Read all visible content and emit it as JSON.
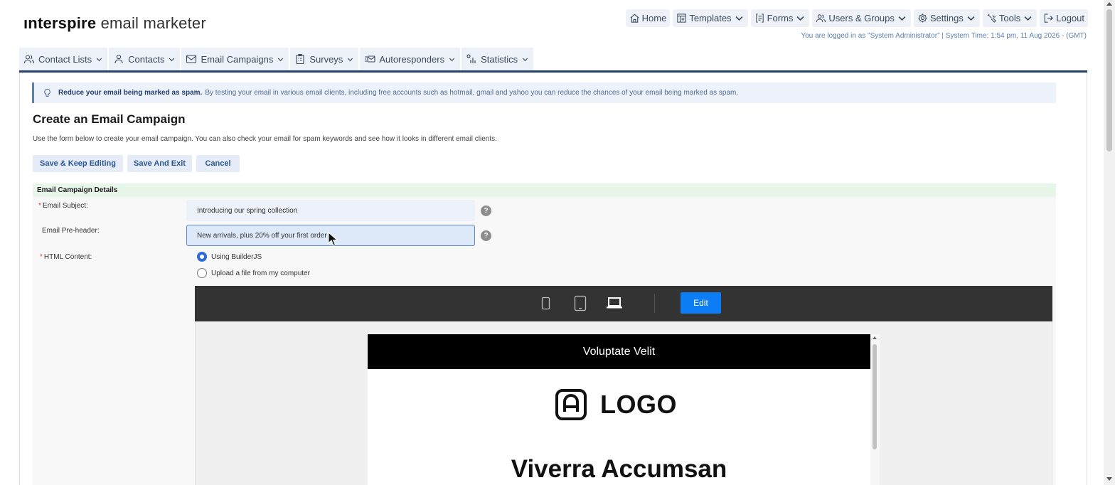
{
  "header": {
    "logo_bold": "ınterspire",
    "logo_light": " email marketer",
    "login_info": "You are logged in as \"System Administrator\" | System Time: 1:54 pm, 11 Aug 2026 - (GMT)"
  },
  "topnav": [
    {
      "label": "Home",
      "icon": "home-icon"
    },
    {
      "label": "Templates",
      "icon": "templates-icon",
      "dropdown": true
    },
    {
      "label": "Forms",
      "icon": "forms-icon",
      "dropdown": true
    },
    {
      "label": "Users & Groups",
      "icon": "users-icon",
      "dropdown": true
    },
    {
      "label": "Settings",
      "icon": "gear-icon",
      "dropdown": true
    },
    {
      "label": "Tools",
      "icon": "tools-icon",
      "dropdown": true
    },
    {
      "label": "Logout",
      "icon": "logout-icon"
    }
  ],
  "mainmenu": [
    {
      "label": "Contact Lists",
      "icon": "contact-lists-icon"
    },
    {
      "label": "Contacts",
      "icon": "contacts-icon"
    },
    {
      "label": "Email Campaigns",
      "icon": "envelope-icon"
    },
    {
      "label": "Surveys",
      "icon": "clipboard-icon"
    },
    {
      "label": "Autoresponders",
      "icon": "autoresponder-icon"
    },
    {
      "label": "Statistics",
      "icon": "statistics-icon"
    }
  ],
  "tip": {
    "bold": "Reduce your email being marked as spam.",
    "text": "By testing your email in various email clients, including free accounts such as hotmail, gmail and yahoo you can reduce the chances of your email being marked as spam."
  },
  "page": {
    "title": "Create an Email Campaign",
    "intro": "Use the form below to create your email campaign. You can also check your email for spam keywords and see how it looks in different email clients."
  },
  "buttons": {
    "save_keep": "Save & Keep Editing",
    "save_exit": "Save And Exit",
    "cancel": "Cancel"
  },
  "form": {
    "section_title": "Email Campaign Details",
    "subject_label": "Email Subject:",
    "subject_value": "Introducing our spring collection",
    "preheader_label": "Email Pre-header:",
    "preheader_value": "New arrivals, plus 20% off your first order",
    "html_label": "HTML Content:",
    "option_builder": "Using BuilderJS",
    "option_upload": "Upload a file from my computer",
    "required_mark": "*",
    "help_mark": "?"
  },
  "builder": {
    "edit_label": "Edit",
    "devices": [
      "mobile-icon",
      "tablet-icon",
      "laptop-icon"
    ],
    "active_device": "laptop-icon",
    "email_top_text": "Voluptate Velit",
    "logo_text": "LOGO",
    "heading": "Viverra Accumsan"
  },
  "colors": {
    "nav_bg": "#edf2f9",
    "accent_navy": "#233e6b",
    "button_text": "#2b5797",
    "section_green": "#e8f6e9",
    "edit_blue": "#0d7df5",
    "builder_bar": "#333333"
  }
}
